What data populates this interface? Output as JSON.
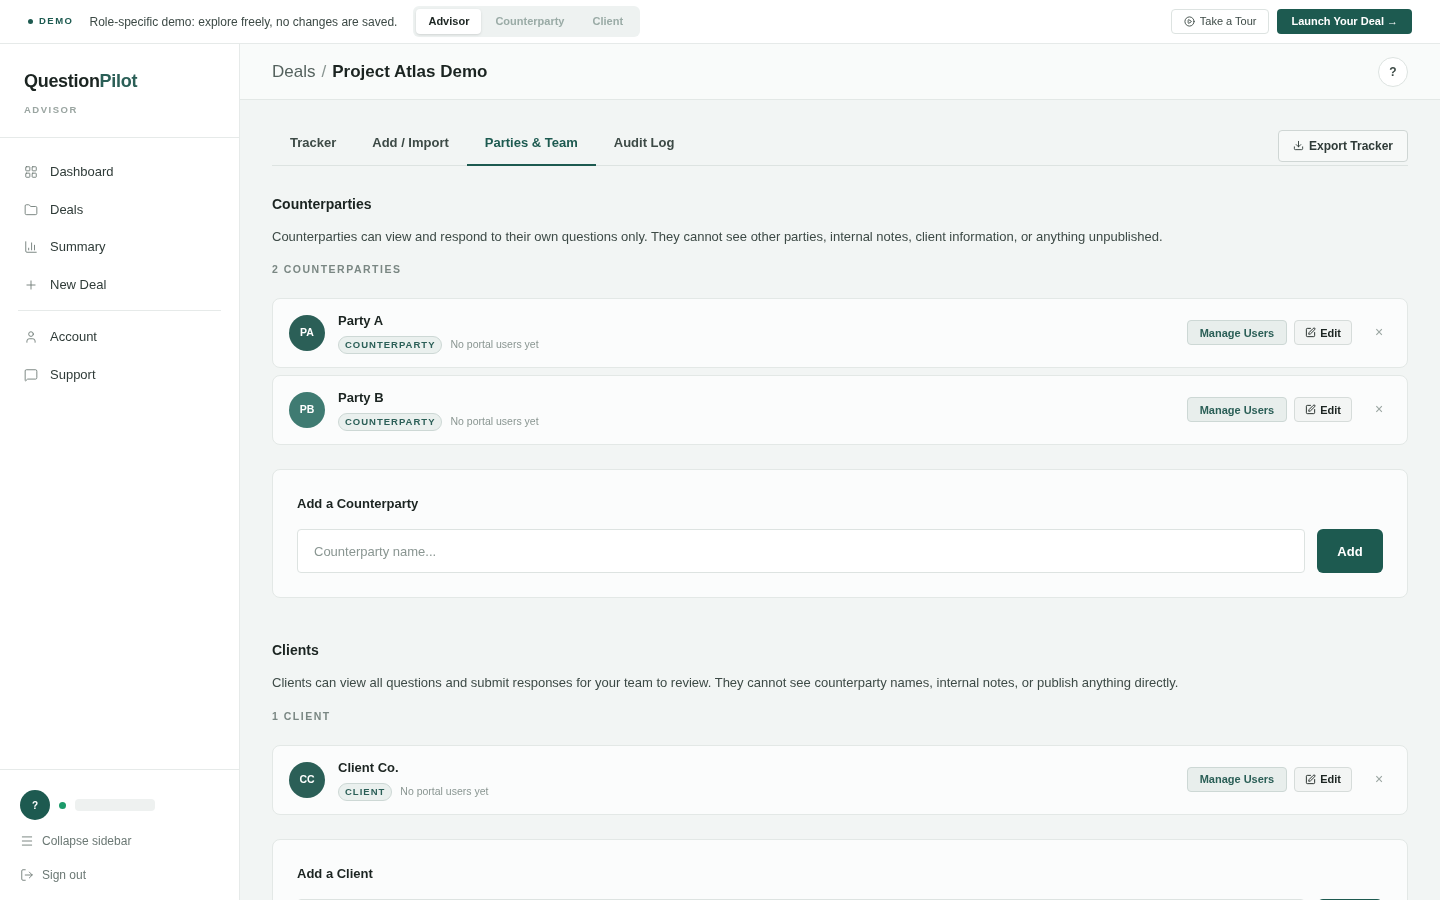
{
  "demo_bar": {
    "badge": "DEMO",
    "message": "Role-specific demo: explore freely, no changes are saved.",
    "roles": [
      {
        "label": "Advisor",
        "selected": true
      },
      {
        "label": "Counterparty",
        "selected": false
      },
      {
        "label": "Client",
        "selected": false
      }
    ],
    "tour_button": "Take a Tour",
    "launch_button": "Launch Your Deal →"
  },
  "sidebar": {
    "brand_first": "Question",
    "brand_second": "Pilot",
    "role": "ADVISOR",
    "items": [
      {
        "label": "Dashboard"
      },
      {
        "label": "Deals"
      },
      {
        "label": "Summary"
      },
      {
        "label": "New Deal"
      }
    ],
    "account_items": [
      {
        "label": "Account"
      },
      {
        "label": "Support"
      }
    ],
    "user_avatar": "?",
    "collapse": "Collapse sidebar",
    "sign_out": "Sign out"
  },
  "header": {
    "breadcrumb_parent": "Deals",
    "separator": "/",
    "title": "Project Atlas Demo",
    "help": "?"
  },
  "tabs": [
    {
      "label": "Tracker",
      "selected": false
    },
    {
      "label": "Add / Import",
      "selected": false
    },
    {
      "label": "Parties & Team",
      "selected": true
    },
    {
      "label": "Audit Log",
      "selected": false
    }
  ],
  "export_button": "Export Tracker",
  "sections": [
    {
      "title": "Counterparties",
      "description": "Counterparties can view and respond to their own questions only. They cannot see other parties, internal notes, client information, or anything unpublished.",
      "count": "2 COUNTERPARTIES",
      "parties": [
        {
          "initials": "PA",
          "name": "Party A",
          "color": "#2b5f57",
          "tag": "COUNTERPARTY",
          "status": "No portal users yet",
          "manage": "Manage Users",
          "edit": "Edit",
          "remove": "×"
        },
        {
          "initials": "PB",
          "name": "Party B",
          "color": "#3f7b72",
          "tag": "COUNTERPARTY",
          "status": "No portal users yet",
          "manage": "Manage Users",
          "edit": "Edit",
          "remove": "×"
        }
      ],
      "add_form": {
        "title": "Add a Counterparty",
        "placeholder": "Counterparty name...",
        "button": "Add"
      }
    },
    {
      "title": "Clients",
      "description": "Clients can view all questions and submit responses for your team to review. They cannot see counterparty names, internal notes, or publish anything directly.",
      "count": "1 CLIENT",
      "parties": [
        {
          "initials": "CC",
          "name": "Client Co.",
          "color": "#2b5f57",
          "tag": "CLIENT",
          "status": "No portal users yet",
          "manage": "Manage Users",
          "edit": "Edit",
          "remove": "×"
        }
      ],
      "add_form": {
        "title": "Add a Client"
      }
    }
  ]
}
